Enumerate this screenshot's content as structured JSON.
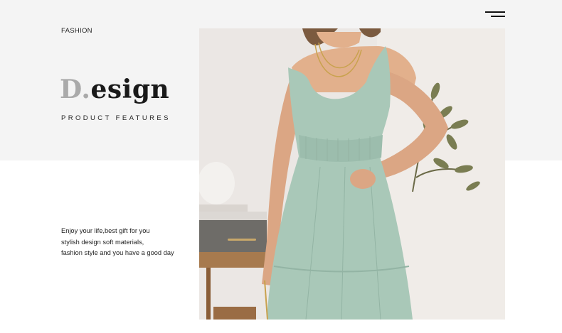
{
  "header": {
    "menu_icon": "hamburger-menu-icon"
  },
  "hero": {
    "category": "FASHION",
    "title_initial": "D.",
    "title_rest": "esign",
    "subtitle": "PRODUCT FEATURES",
    "description_lines": [
      "Enjoy your life,best gift for you",
      "stylish design soft materials,",
      "fashion style and you have a good day"
    ]
  },
  "colors": {
    "band_background": "#f4f4f4",
    "dress": "#a9c8b8",
    "title_initial": "#aaaaaa"
  }
}
